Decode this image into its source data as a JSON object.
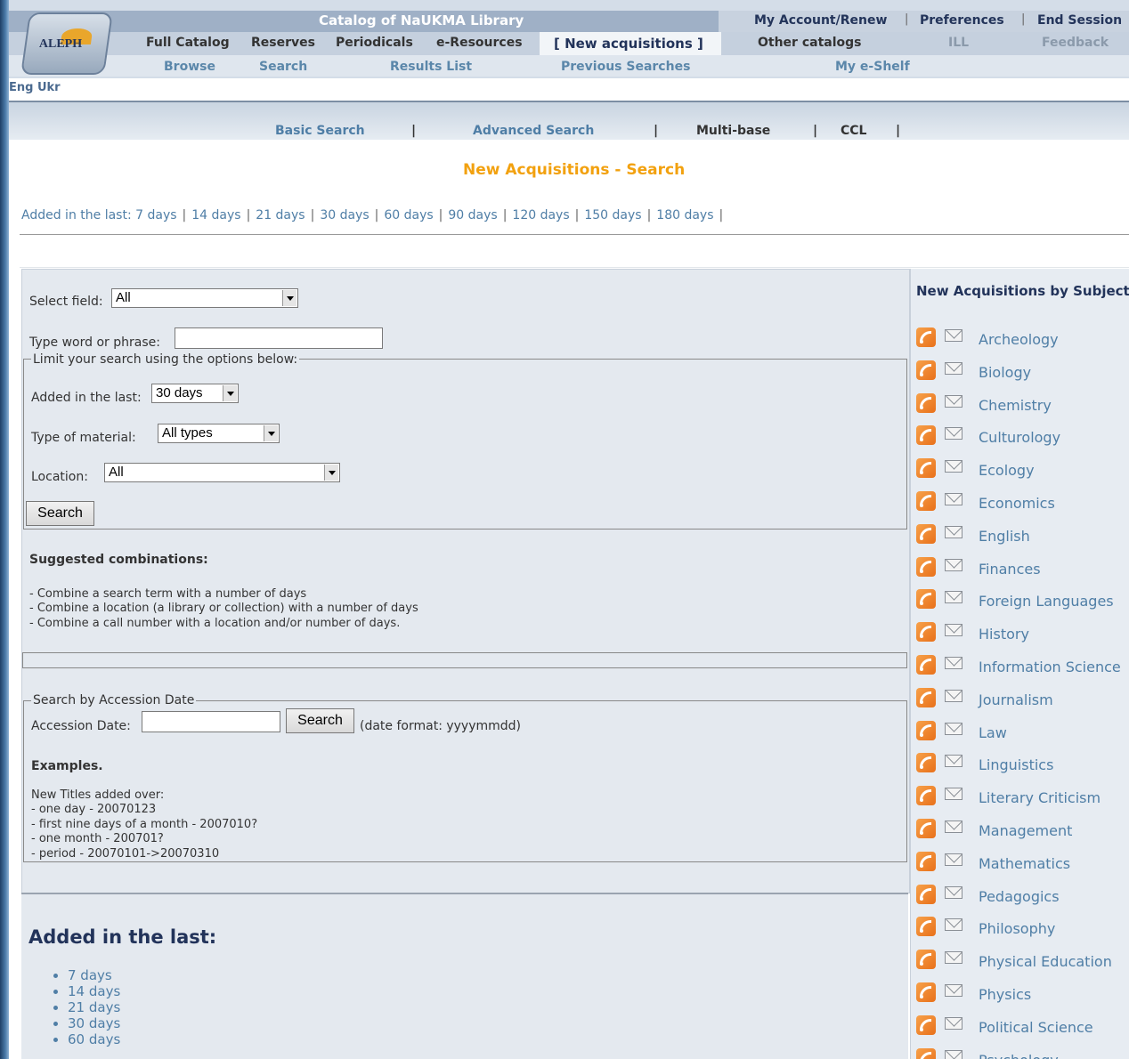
{
  "app": {
    "title": "Catalog of NaUKMA Library",
    "logo_text": "ALEPH"
  },
  "header": {
    "account_links": [
      "My Account/Renew",
      "Preferences",
      "End Session"
    ],
    "nav_main": [
      "Full Catalog",
      "Reserves",
      "Periodicals",
      "e-Resources",
      "[ New acquisitions ]",
      "Other catalogs",
      "ILL",
      "Feedback"
    ],
    "nav_sub": [
      "Browse",
      "Search",
      "Results List",
      "Previous Searches",
      "My e-Shelf"
    ],
    "language": "Eng Ukr"
  },
  "search_modes": [
    "Basic Search",
    "Advanced Search",
    "Multi-base",
    "CCL"
  ],
  "page_title": "New Acquisitions - Search",
  "added_in_last": {
    "label": "Added in the last:",
    "options": [
      "7 days",
      "14 days",
      "21 days",
      "30 days",
      "60 days",
      "90 days",
      "120 days",
      "150 days",
      "180 days"
    ]
  },
  "search_form": {
    "select_field_label": "Select field:",
    "select_field_value": "All",
    "type_phrase_label": "Type word or phrase:",
    "type_phrase_value": "",
    "limit_legend": "Limit your search using the options below:",
    "added_label": "Added in the last:",
    "added_value": "30 days",
    "type_material_label": "Type of material:",
    "type_material_value": "All types",
    "location_label": "Location:",
    "location_value": "All",
    "search_button": "Search"
  },
  "suggested": {
    "title": "Suggested combinations:",
    "lines": [
      "- Combine a search term with a number of days",
      "- Combine a location (a library or collection) with a number of days",
      "- Combine a call number with a location and/or number of days."
    ]
  },
  "accession": {
    "legend": "Search by Accession Date",
    "label": "Accession Date:",
    "value": "",
    "button": "Search",
    "format_hint": "(date format: yyyymmdd)",
    "examples_title": "Examples.",
    "examples_intro": "New Titles added over:",
    "examples": [
      "- one day - 20070123",
      "- first nine days of a month - 2007010?",
      "- one month - 200701?",
      "- period - 20070101->20070310"
    ]
  },
  "added_list": {
    "title": "Added in the last:",
    "items": [
      "7 days",
      "14 days",
      "21 days",
      "30 days",
      "60 days"
    ]
  },
  "subjects": {
    "title": "New Acquisitions by Subject",
    "items": [
      "Archeology",
      "Biology",
      "Chemistry",
      "Culturology",
      "Ecology",
      "Economics",
      "English",
      "Finances",
      "Foreign Languages",
      "History",
      "Information Science",
      "Journalism",
      "Law",
      "Linguistics",
      "Literary Criticism",
      "Management",
      "Mathematics",
      "Pedagogics",
      "Philosophy",
      "Physical Education",
      "Physics",
      "Political Science",
      "Psychology"
    ]
  },
  "colors": {
    "title_orange": "#f2a10f",
    "link_blue": "#4f7ea6",
    "header_blue": "#9fb0c6"
  }
}
